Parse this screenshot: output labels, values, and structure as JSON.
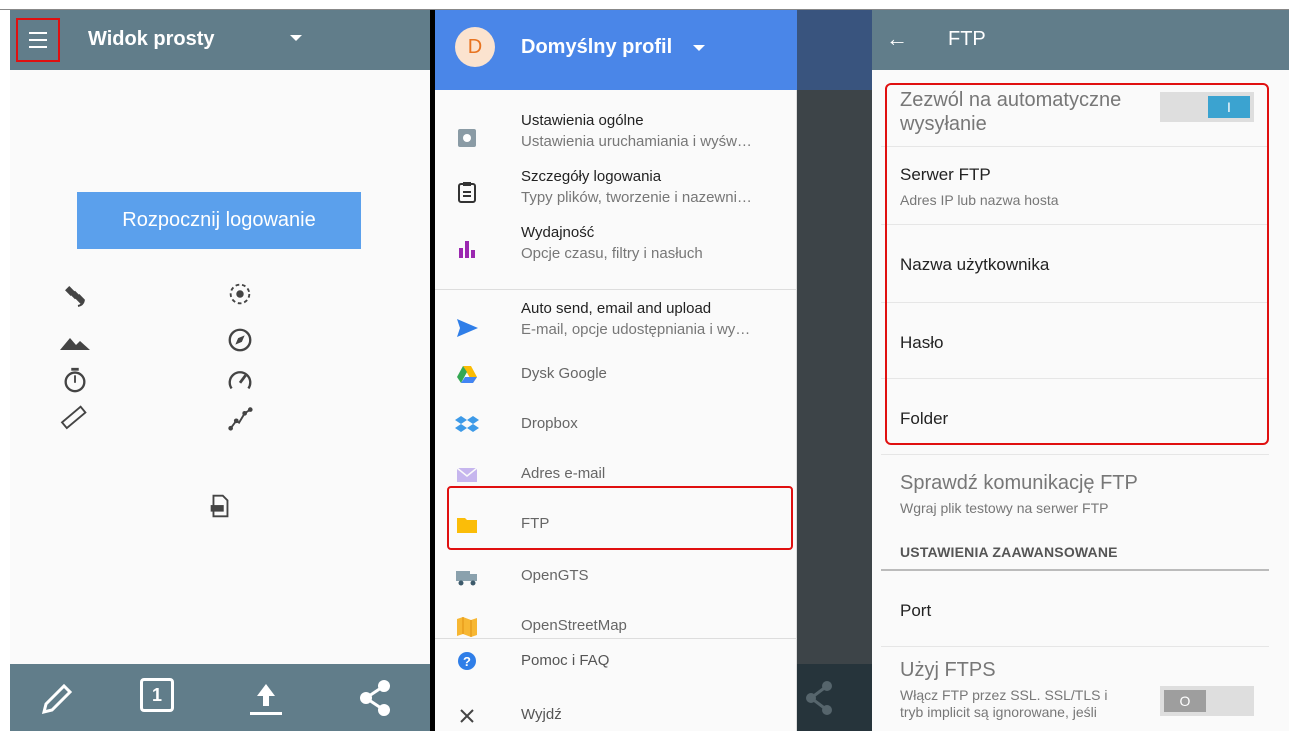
{
  "left_panel": {
    "title": "Widok prosty",
    "start_button": "Rozpocznij logowanie",
    "icons": [
      "satellite-icon",
      "gps-fixed-icon",
      "terrain-icon",
      "compass-icon",
      "timer-icon",
      "speedometer-icon",
      "ruler-icon",
      "track-points-icon",
      "file-icon"
    ],
    "bottom_bar": {
      "page_number": "1",
      "icons": [
        "pencil-icon",
        "page-number-icon",
        "upload-icon",
        "share-icon"
      ]
    }
  },
  "drawer": {
    "avatar_letter": "D",
    "profile_name": "Domyślny profil",
    "items": [
      {
        "title": "Ustawienia ogólne",
        "subtitle": "Ustawienia uruchamiania i wyśw…",
        "icon": "settings-icon"
      },
      {
        "title": "Szczegóły logowania",
        "subtitle": "Typy plików, tworzenie i nazewni…",
        "icon": "clipboard-icon"
      },
      {
        "title": "Wydajność",
        "subtitle": "Opcje czasu, filtry i nasłuch",
        "icon": "bar-chart-icon"
      },
      {
        "title": "Auto send, email and upload",
        "subtitle": "E-mail, opcje udostępniania i wy…",
        "icon": "send-icon"
      },
      {
        "title": "Dysk Google",
        "icon": "google-drive-icon"
      },
      {
        "title": "Dropbox",
        "icon": "dropbox-icon"
      },
      {
        "title": "Adres e-mail",
        "icon": "email-icon"
      },
      {
        "title": "FTP",
        "icon": "folder-icon"
      },
      {
        "title": "OpenGTS",
        "icon": "truck-icon"
      },
      {
        "title": "OpenStreetMap",
        "icon": "map-icon"
      },
      {
        "title": "Pomoc i FAQ",
        "icon": "help-icon"
      },
      {
        "title": "Wyjdź",
        "icon": "close-icon"
      }
    ]
  },
  "ftp_settings": {
    "title": "FTP",
    "auto_send": {
      "label": "Zezwól na automatyczne wysyłanie",
      "state": "on",
      "knob": "I"
    },
    "server": {
      "label": "Serwer FTP",
      "subtitle": "Adres IP lub nazwa hosta"
    },
    "username": "Nazwa użytkownika",
    "password": "Hasło",
    "folder": "Folder",
    "test": {
      "label": "Sprawdź komunikację FTP",
      "subtitle": "Wgraj plik testowy na serwer FTP"
    },
    "advanced_header": "USTAWIENIA ZAAWANSOWANE",
    "port": "Port",
    "ftps": {
      "label": "Użyj FTPS",
      "subtitle_line1": "Włącz FTP przez SSL. SSL/TLS i",
      "subtitle_line2": "tryb implicit są ignorowane, jeśli",
      "state": "off",
      "knob": "O"
    }
  },
  "colors": {
    "toolbar": "#617d8a",
    "accent_blue": "#4a86e8",
    "button_blue": "#5ba0ec",
    "highlight_red": "#e01010",
    "toggle_on": "#3ba3d0"
  }
}
